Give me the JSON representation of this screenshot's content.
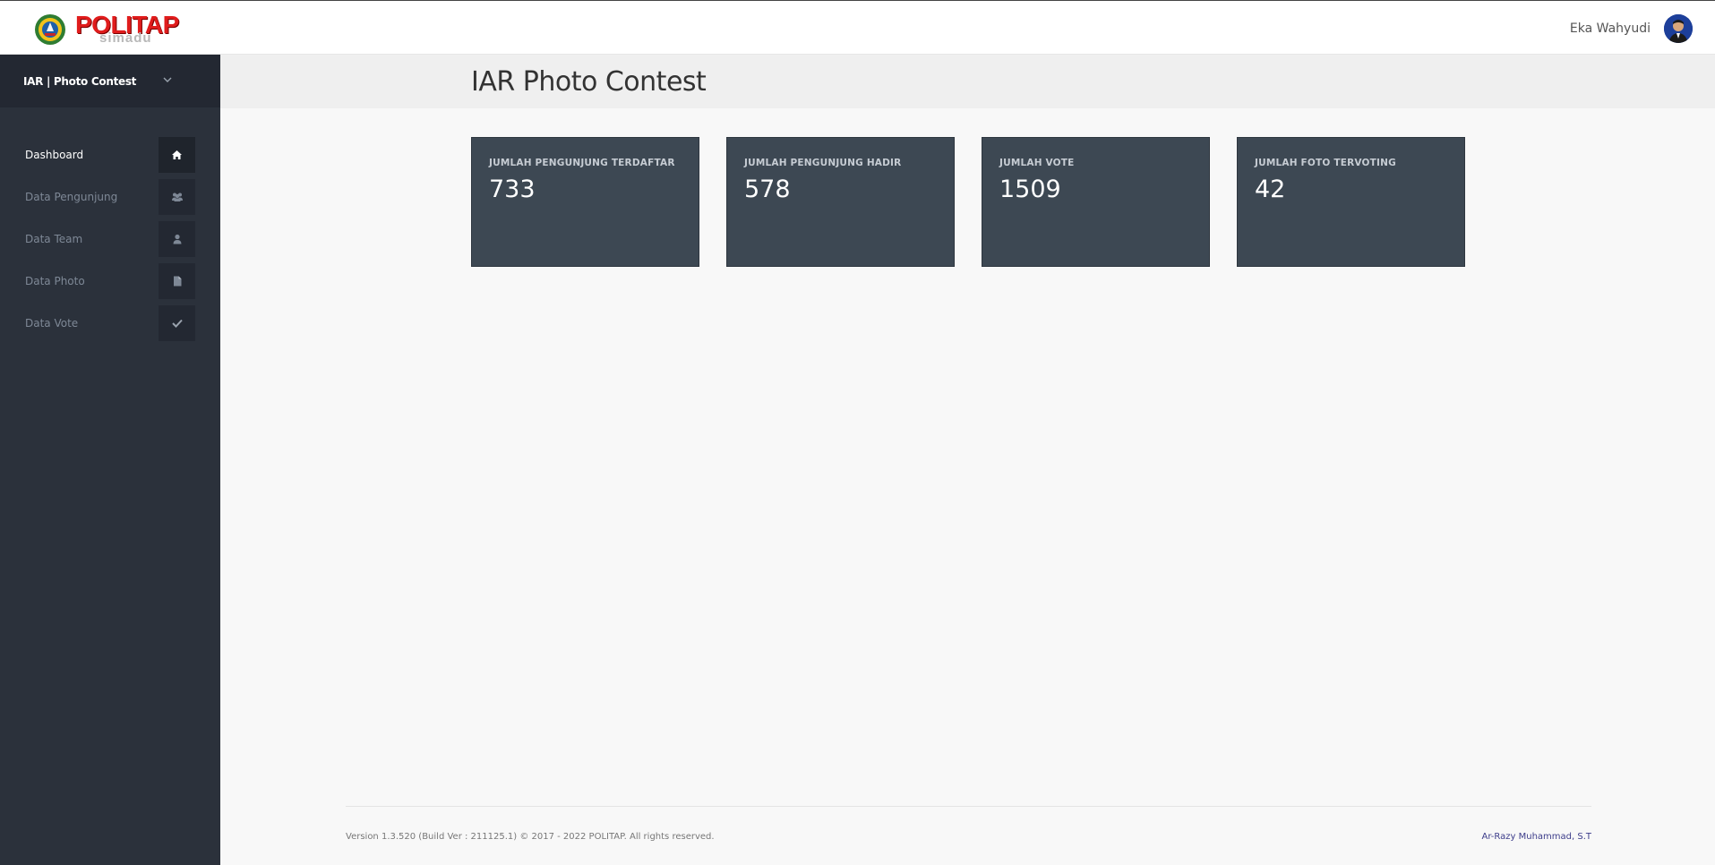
{
  "header": {
    "logo_main": "POLITAP",
    "logo_sub": "simadu",
    "user_name": "Eka Wahyudi"
  },
  "sidebar": {
    "app_name": "IAR | Photo Contest",
    "items": [
      {
        "label": "Dashboard",
        "icon": "home-icon",
        "active": true
      },
      {
        "label": "Data Pengunjung",
        "icon": "users-icon",
        "active": false
      },
      {
        "label": "Data Team",
        "icon": "user-icon",
        "active": false
      },
      {
        "label": "Data Photo",
        "icon": "file-icon",
        "active": false
      },
      {
        "label": "Data Vote",
        "icon": "check-icon",
        "active": false
      }
    ]
  },
  "main": {
    "title": "IAR Photo Contest",
    "stats": [
      {
        "label": "JUMLAH PENGUNJUNG TERDAFTAR",
        "value": "733"
      },
      {
        "label": "JUMLAH PENGUNJUNG HADIR",
        "value": "578"
      },
      {
        "label": "JUMLAH VOTE",
        "value": "1509"
      },
      {
        "label": "JUMLAH FOTO TERVOTING",
        "value": "42"
      }
    ]
  },
  "footer": {
    "version": "Version 1.3.520 (Build Ver : 211125.1) © 2017 - 2022 POLITAP. All rights reserved.",
    "author": "Ar-Razy Muhammad, S.T"
  },
  "colors": {
    "sidebar_bg": "#2b313b",
    "card_bg": "#3d4853",
    "logo_red": "#e01c1c"
  }
}
